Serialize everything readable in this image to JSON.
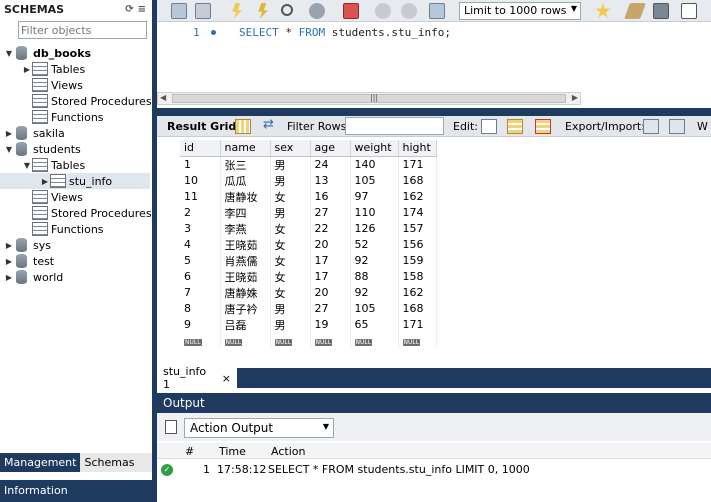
{
  "navigator": {
    "title": "SCHEMAS",
    "filter_placeholder": "Filter objects",
    "tree": {
      "db_books": "db_books",
      "db_books_tables": "Tables",
      "db_books_views": "Views",
      "db_books_procs": "Stored Procedures",
      "db_books_funcs": "Functions",
      "sakila": "sakila",
      "students": "students",
      "students_tables": "Tables",
      "stu_info": "stu_info",
      "students_views": "Views",
      "students_procs": "Stored Procedures",
      "students_funcs": "Functions",
      "sys": "sys",
      "test": "test",
      "world": "world"
    },
    "tabs": [
      "Management",
      "Schemas"
    ],
    "info_label": "Information"
  },
  "editor": {
    "limit_option": "Limit to 1000 rows",
    "line_number": "1",
    "sql_keyword_select": "SELECT",
    "sql_star": " * ",
    "sql_keyword_from": "FROM",
    "sql_rest": " students.stu_info;"
  },
  "result_toolbar": {
    "result_grid_label": "Result Grid",
    "filter_rows_label": "Filter Rows:",
    "edit_label": "Edit:",
    "export_label": "Export/Import:",
    "wrap_label": "W"
  },
  "grid": {
    "columns": [
      "id",
      "name",
      "sex",
      "age",
      "weight",
      "hight"
    ],
    "rows": [
      [
        "1",
        "张三",
        "男",
        "24",
        "140",
        "171"
      ],
      [
        "10",
        "瓜瓜",
        "男",
        "13",
        "105",
        "168"
      ],
      [
        "11",
        "唐静妆",
        "女",
        "16",
        "97",
        "162"
      ],
      [
        "2",
        "李四",
        "男",
        "27",
        "110",
        "174"
      ],
      [
        "3",
        "李燕",
        "女",
        "22",
        "126",
        "157"
      ],
      [
        "4",
        "王晓茹",
        "女",
        "20",
        "52",
        "156"
      ],
      [
        "5",
        "肖燕儒",
        "女",
        "17",
        "92",
        "159"
      ],
      [
        "6",
        "王晓茹",
        "女",
        "17",
        "88",
        "158"
      ],
      [
        "7",
        "唐静姝",
        "女",
        "20",
        "92",
        "162"
      ],
      [
        "8",
        "唐子衿",
        "男",
        "27",
        "105",
        "168"
      ],
      [
        "9",
        "吕磊",
        "男",
        "19",
        "65",
        "171"
      ]
    ],
    "null_label": "NULL"
  },
  "result_tab": {
    "label": "stu_info 1",
    "close": "×"
  },
  "output": {
    "title": "Output",
    "select_value": "Action Output",
    "columns": [
      "#",
      "Time",
      "Action"
    ],
    "row": {
      "num": "1",
      "time": "17:58:12",
      "action": "SELECT * FROM students.stu_info LIMIT 0, 1000"
    }
  },
  "colors": {
    "dark_blue": "#1e3a5f",
    "keyword": "#2c6fb3",
    "success": "#2f9e44"
  }
}
